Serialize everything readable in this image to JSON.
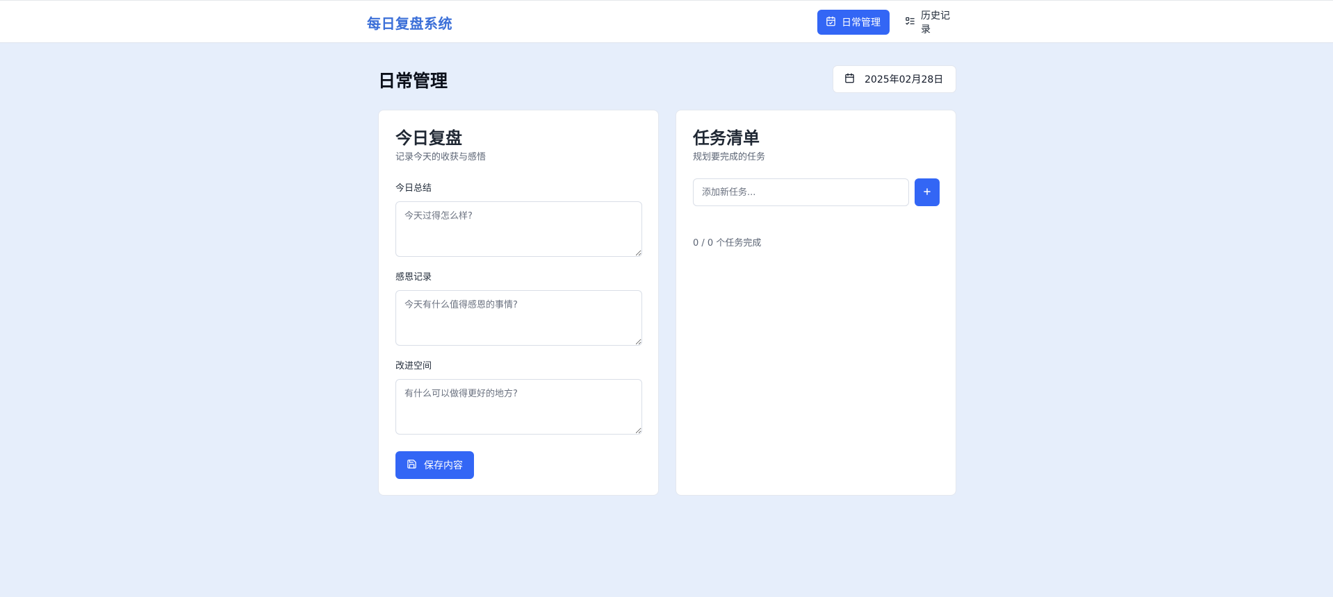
{
  "app": {
    "brand": "每日复盘系统"
  },
  "nav": {
    "items": [
      {
        "label": "日常管理",
        "icon": "calendar-check-icon",
        "active": true
      },
      {
        "label": "历史记录",
        "icon": "list-checks-icon",
        "active": false
      }
    ]
  },
  "page": {
    "title": "日常管理",
    "date": "2025年02月28日",
    "date_icon": "calendar-icon"
  },
  "review": {
    "title": "今日复盘",
    "subtitle": "记录今天的收获与感悟",
    "fields": [
      {
        "label": "今日总结",
        "placeholder": "今天过得怎么样?",
        "value": ""
      },
      {
        "label": "感恩记录",
        "placeholder": "今天有什么值得感恩的事情?",
        "value": ""
      },
      {
        "label": "改进空间",
        "placeholder": "有什么可以做得更好的地方?",
        "value": ""
      }
    ],
    "save_label": "保存内容",
    "save_icon": "save-icon"
  },
  "tasks": {
    "title": "任务清单",
    "subtitle": "规划要完成的任务",
    "input_placeholder": "添加新任务...",
    "add_icon": "plus-icon",
    "progress": "0 / 0 个任务完成"
  },
  "colors": {
    "background": "#e6eefb",
    "brand": "#3b6fd8",
    "accent": "#3366f5",
    "card": "#ffffff"
  }
}
